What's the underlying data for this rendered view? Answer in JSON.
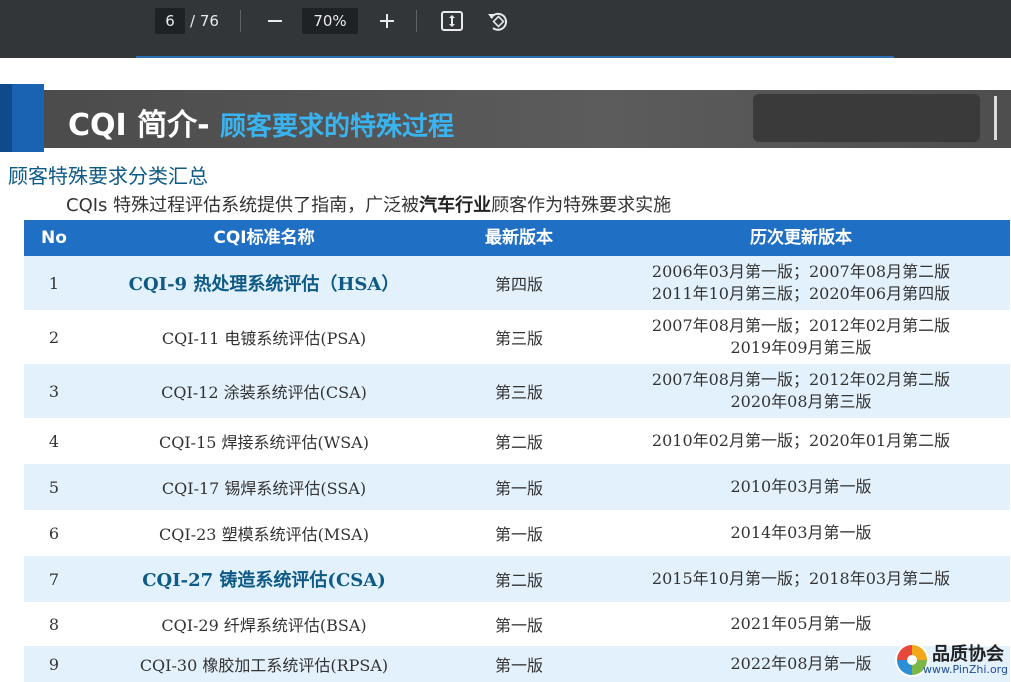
{
  "toolbar": {
    "page_current": "6",
    "page_total": "/ 76",
    "zoom": "70%",
    "zoom_out_icon": "minus-icon",
    "zoom_in_icon": "plus-icon",
    "fit_icon": "fit-page-icon",
    "rotate_icon": "rotate-icon"
  },
  "slide": {
    "title_main": "CQI 简介-",
    "title_sub": "顾客要求的特殊过程",
    "section_title": "顾客特殊要求分类汇总",
    "intro_prefix": "CQIs 特殊过程评估系统提供了指南，广泛被",
    "intro_bold": "汽车行业",
    "intro_suffix": "顾客作为特殊要求实施"
  },
  "table": {
    "headers": [
      "No",
      "CQI标准名称",
      "最新版本",
      "历次更新版本"
    ],
    "rows": [
      {
        "no": "1",
        "name": "CQI-9 热处理系统评估（HSA）",
        "version": "第四版",
        "history1": "2006年03月第一版；2007年08月第二版",
        "history2": "2011年10月第三版；2020年06月第四版"
      },
      {
        "no": "2",
        "name": "CQI-11 电镀系统评估(PSA)",
        "version": "第三版",
        "history1": "2007年08月第一版；2012年02月第二版",
        "history2": "2019年09月第三版"
      },
      {
        "no": "3",
        "name": "CQI-12 涂装系统评估(CSA)",
        "version": "第三版",
        "history1": "2007年08月第一版；2012年02月第二版",
        "history2": "2020年08月第三版"
      },
      {
        "no": "4",
        "name": "CQI-15 焊接系统评估(WSA)",
        "version": "第二版",
        "history1": "2010年02月第一版；2020年01月第二版",
        "history2": ""
      },
      {
        "no": "5",
        "name": "CQI-17 锡焊系统评估(SSA)",
        "version": "第一版",
        "history1": "2010年03月第一版",
        "history2": ""
      },
      {
        "no": "6",
        "name": "CQI-23 塑模系统评估(MSA)",
        "version": "第一版",
        "history1": "2014年03月第一版",
        "history2": ""
      },
      {
        "no": "7",
        "name": "CQI-27 铸造系统评估(CSA)",
        "version": "第二版",
        "history1": "2015年10月第一版；2018年03月第二版",
        "history2": ""
      },
      {
        "no": "8",
        "name": "CQI-29 纤焊系统评估(BSA)",
        "version": "第一版",
        "history1": "2021年05月第一版",
        "history2": ""
      },
      {
        "no": "9",
        "name": "CQI-30 橡胶加工系统评估(RPSA)",
        "version": "第一版",
        "history1": "2022年08月第一版",
        "history2": ""
      }
    ]
  },
  "watermark": {
    "name": "品质协会",
    "url": "www.PinZhi.org"
  }
}
